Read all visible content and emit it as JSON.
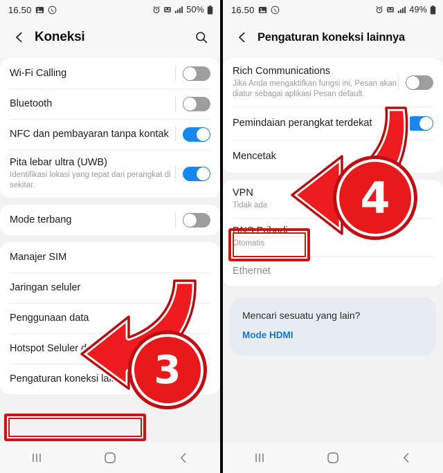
{
  "left": {
    "status": {
      "time": "16.50",
      "battery": "50%",
      "icons": [
        "photo-icon",
        "whatsapp-icon",
        "alarm-icon",
        "dnd-icon",
        "signal-icon",
        "battery-icon"
      ]
    },
    "appbar": {
      "title": "Koneksi",
      "back": "back-arrow-icon",
      "search": "search-icon"
    },
    "groups": [
      {
        "items": [
          {
            "title": "Wi-Fi Calling",
            "sub": "",
            "toggle": "off"
          },
          {
            "title": "Bluetooth",
            "sub": "",
            "toggle": "off"
          },
          {
            "title": "NFC dan pembayaran tanpa kontak",
            "sub": "",
            "toggle": "on"
          },
          {
            "title": "Pita lebar ultra (UWB)",
            "sub": "Identifikasi lokasi yang tepat dari perangkat di sekitar.",
            "toggle": "on"
          }
        ]
      },
      {
        "items": [
          {
            "title": "Mode terbang",
            "sub": "",
            "toggle": "off"
          }
        ]
      },
      {
        "items": [
          {
            "title": "Manajer SIM",
            "sub": "",
            "toggle": ""
          },
          {
            "title": "Jaringan seluler",
            "sub": "",
            "toggle": ""
          },
          {
            "title": "Penggunaan data",
            "sub": "",
            "toggle": ""
          },
          {
            "title": "Hotspot Seluler dan Penambatan",
            "sub": "",
            "toggle": ""
          },
          {
            "title": "Pengaturan koneksi lainnya",
            "sub": "",
            "toggle": ""
          }
        ]
      }
    ],
    "nav": {
      "recents": "recents-icon",
      "home": "home-icon",
      "back": "back-nav-icon"
    },
    "annotation": {
      "number": "3"
    }
  },
  "right": {
    "status": {
      "time": "16.50",
      "battery": "49%",
      "icons": [
        "photo-icon",
        "whatsapp-icon",
        "alarm-icon",
        "dnd-icon",
        "signal-icon",
        "battery-icon"
      ]
    },
    "appbar": {
      "title": "Pengaturan koneksi lainnya",
      "back": "back-arrow-icon"
    },
    "groups": [
      {
        "items": [
          {
            "title": "Rich Communications",
            "sub": "Jika Anda mengaktifkan fungsi ini, Pesan akan diatur sebagai aplikasi Pesan default.",
            "toggle": "off"
          },
          {
            "title": "Pemindaian perangkat terdekat",
            "sub": "",
            "toggle": "on"
          },
          {
            "title": "Mencetak",
            "sub": "",
            "toggle": ""
          }
        ]
      },
      {
        "items": [
          {
            "title": "VPN",
            "sub": "Tidak ada",
            "toggle": ""
          },
          {
            "title": "DNS Pribadi",
            "sub": "Otomatis",
            "toggle": ""
          },
          {
            "title": "Ethernet",
            "sub": "",
            "toggle": "",
            "dim": true
          }
        ]
      }
    ],
    "hint": {
      "question": "Mencari sesuatu yang lain?",
      "link": "Mode HDMI"
    },
    "nav": {
      "recents": "recents-icon",
      "home": "home-icon",
      "back": "back-nav-icon"
    },
    "annotation": {
      "number": "4"
    }
  },
  "colors": {
    "accent": "#1a87f0",
    "annotation_red": "#e8191b",
    "annotation_red_dark": "#cc1417",
    "link": "#1c74c9",
    "hint_bg": "#e6ecf2"
  }
}
